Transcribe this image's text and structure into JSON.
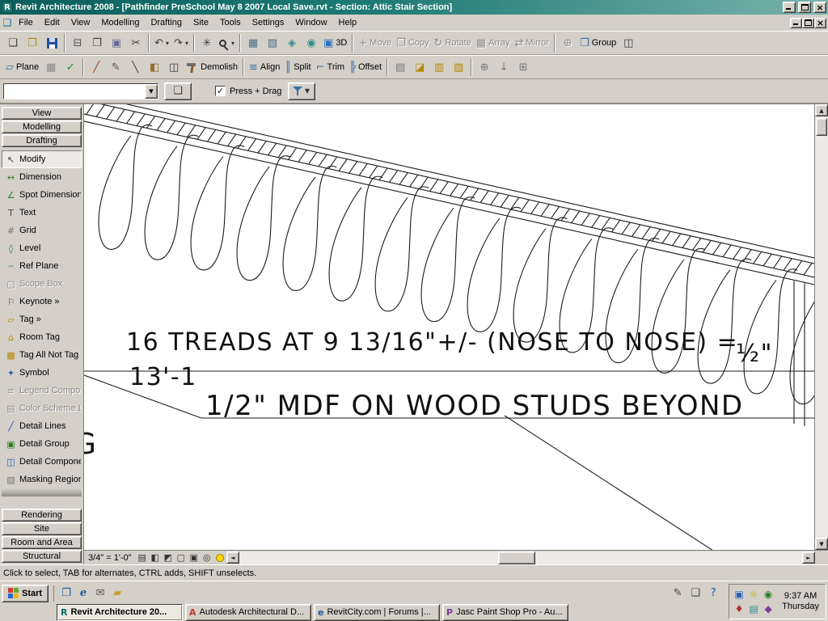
{
  "window": {
    "title": "Revit Architecture 2008 - [Pathfinder PreSchool May 8 2007 Local Save.rvt - Section: Attic Stair Section]",
    "app_icon_letter": "R",
    "close_glyph": "×"
  },
  "glyphs": {
    "up": "▲",
    "down": "▼",
    "left": "◄",
    "right": "►",
    "combo_caret": "▼"
  },
  "menu": {
    "doc_icon_glyph": "❏",
    "items": [
      {
        "name": "menu-file",
        "label": "File"
      },
      {
        "name": "menu-edit",
        "label": "Edit"
      },
      {
        "name": "menu-view",
        "label": "View"
      },
      {
        "name": "menu-modelling",
        "label": "Modelling"
      },
      {
        "name": "menu-drafting",
        "label": "Drafting"
      },
      {
        "name": "menu-site",
        "label": "Site"
      },
      {
        "name": "menu-tools",
        "label": "Tools"
      },
      {
        "name": "menu-settings",
        "label": "Settings"
      },
      {
        "name": "menu-window",
        "label": "Window"
      },
      {
        "name": "menu-help",
        "label": "Help"
      }
    ]
  },
  "toolbar1": {
    "items": [
      {
        "name": "new-button",
        "glyph": "❏"
      },
      {
        "name": "open-button",
        "glyph": "❒",
        "color": "#b8860b"
      },
      {
        "name": "save-button",
        "cls": "floppy",
        "glyph": " "
      },
      {
        "sep": true
      },
      {
        "name": "print-button",
        "glyph": "⊟",
        "color": "#555"
      },
      {
        "name": "copy-button",
        "glyph": "❐"
      },
      {
        "name": "paste-button",
        "glyph": "▣",
        "color": "#6b6b9a"
      },
      {
        "name": "cut-button",
        "glyph": "✂"
      },
      {
        "sep": true
      },
      {
        "name": "undo-button",
        "glyph": "↶",
        "caret": "▾"
      },
      {
        "name": "redo-button",
        "glyph": "↷",
        "caret": "▾"
      },
      {
        "sep": true
      },
      {
        "name": "thin-lines-button",
        "glyph": "✳"
      },
      {
        "name": "zoom-button",
        "cls": "mag",
        "glyph": " ",
        "caret": "▾"
      },
      {
        "sep": true
      },
      {
        "name": "worksets-button",
        "glyph": "▦",
        "color": "#4a708b"
      },
      {
        "name": "design-options-button",
        "glyph": "▧",
        "color": "#4a708b"
      },
      {
        "name": "dynamic-view-button",
        "glyph": "◈",
        "color": "#2e8b8b"
      },
      {
        "name": "camera-button",
        "glyph": "◉",
        "color": "#2e8b8b"
      },
      {
        "name": "default-3d-button",
        "glyph": "▣",
        "color": "#2a6fbd",
        "label": "3D"
      },
      {
        "sep": true
      },
      {
        "name": "move-button",
        "glyph": "+",
        "label": "Move",
        "disabled": true
      },
      {
        "name": "copy-tool-button",
        "glyph": "❐",
        "label": "Copy",
        "disabled": true
      },
      {
        "name": "rotate-button",
        "glyph": "↻",
        "label": "Rotate",
        "disabled": true
      },
      {
        "name": "array-button",
        "glyph": "▦",
        "label": "Array",
        "disabled": true
      },
      {
        "name": "mirror-button",
        "glyph": "⇄",
        "label": "Mirror",
        "disabled": true
      },
      {
        "sep": true
      },
      {
        "name": "pin-button",
        "glyph": "⊕",
        "disabled": true
      },
      {
        "name": "group-button",
        "glyph": "❒",
        "label": "Group",
        "color": "#3a6ea5"
      },
      {
        "name": "ungroup-button",
        "glyph": "◫"
      }
    ]
  },
  "toolbar2": {
    "items": [
      {
        "name": "work-plane-button",
        "glyph": "▱",
        "label": "Plane",
        "color": "#3a6ea5"
      },
      {
        "name": "work-plane-grid-button",
        "glyph": "▦",
        "color": "#888"
      },
      {
        "name": "spelling-button",
        "glyph": "✓",
        "color": "#2a7d2a"
      },
      {
        "sep": true
      },
      {
        "name": "tape-measure-button",
        "glyph": "╱",
        "color": "#8b4513"
      },
      {
        "name": "match-type-button",
        "glyph": "✎",
        "color": "#555"
      },
      {
        "name": "linework-button",
        "glyph": "╲"
      },
      {
        "name": "paint-button",
        "glyph": "◧",
        "color": "#9a6a2f"
      },
      {
        "name": "split-face-button",
        "glyph": "◫"
      },
      {
        "name": "demolish-button",
        "cls": "hammer",
        "glyph": " ",
        "label": "Demolish"
      },
      {
        "sep": true
      },
      {
        "name": "align-button",
        "glyph": "≡",
        "label": "Align",
        "color": "#3a6ea5"
      },
      {
        "name": "split-button",
        "glyph": "║",
        "label": "Split",
        "color": "#3a6ea5"
      },
      {
        "name": "trim-button",
        "glyph": "⌐",
        "label": "Trim",
        "color": "#3a6ea5"
      },
      {
        "name": "offset-button",
        "glyph": "╠",
        "label": "Offset",
        "color": "#3a6ea5"
      },
      {
        "sep": true
      },
      {
        "name": "view-window-button",
        "glyph": "▤",
        "color": "#777"
      },
      {
        "name": "callout-button",
        "glyph": "◪",
        "color": "#b8860b"
      },
      {
        "name": "drafting-view-button",
        "glyph": "▥",
        "color": "#b8860b"
      },
      {
        "name": "section-box-button",
        "glyph": "▧",
        "color": "#b8860b"
      },
      {
        "sep": true
      },
      {
        "name": "link-button",
        "glyph": "⊕",
        "color": "#777"
      },
      {
        "name": "import-button",
        "glyph": "↓",
        "color": "#777"
      },
      {
        "name": "manage-links-button",
        "glyph": "⊞",
        "color": "#777"
      }
    ]
  },
  "options": {
    "type_selector_value": "",
    "press_drag_label": "Press + Drag",
    "press_drag_checked": true
  },
  "design_bar": {
    "top_tabs": [
      {
        "name": "designbar-tab-view",
        "label": "View"
      },
      {
        "name": "designbar-tab-modelling",
        "label": "Modelling"
      },
      {
        "name": "designbar-tab-drafting",
        "label": "Drafting"
      }
    ],
    "tools": [
      {
        "name": "tool-modify",
        "glyph": "↖",
        "label": "Modify",
        "selected": true
      },
      {
        "name": "tool-dimension",
        "glyph": "↔",
        "label": "Dimension",
        "color": "#2a7d2a"
      },
      {
        "name": "tool-spot-dimension",
        "glyph": "∠",
        "label": "Spot Dimension",
        "color": "#2a7d2a"
      },
      {
        "name": "tool-text",
        "glyph": "T",
        "label": "Text"
      },
      {
        "name": "tool-grid",
        "glyph": "#",
        "label": "Grid",
        "color": "#777"
      },
      {
        "name": "tool-level",
        "glyph": "◊",
        "label": "Level",
        "color": "#2a7d2a"
      },
      {
        "name": "tool-ref-plane",
        "glyph": "┄",
        "label": "Ref Plane",
        "color": "#2a7d2a"
      },
      {
        "name": "tool-scope-box",
        "glyph": "▢",
        "label": "Scope Box",
        "disabled": true
      },
      {
        "name": "tool-keynote",
        "glyph": "⚐",
        "label": "Keynote »",
        "color": "#8b4513"
      },
      {
        "name": "tool-tag",
        "glyph": "▱",
        "label": "Tag »",
        "color": "#b8860b"
      },
      {
        "name": "tool-room-tag",
        "glyph": "⌂",
        "label": "Room Tag",
        "color": "#b8860b"
      },
      {
        "name": "tool-tag-all",
        "glyph": "▩",
        "label": "Tag All Not Tag",
        "color": "#b8860b"
      },
      {
        "name": "tool-symbol",
        "glyph": "✦",
        "label": "Symbol",
        "color": "#2a5db0"
      },
      {
        "name": "tool-legend-component",
        "glyph": "≡",
        "label": "Legend Compor",
        "disabled": true
      },
      {
        "name": "tool-color-scheme",
        "glyph": "▤",
        "label": "Color Scheme L",
        "disabled": true
      },
      {
        "name": "tool-detail-lines",
        "glyph": "╱",
        "label": "Detail Lines",
        "color": "#2a5db0"
      },
      {
        "name": "tool-detail-group",
        "glyph": "▣",
        "label": "Detail Group",
        "color": "#2a7d2a"
      },
      {
        "name": "tool-detail-component",
        "glyph": "◫",
        "label": "Detail Compone",
        "color": "#2a5db0"
      },
      {
        "name": "tool-masking-region",
        "glyph": "▨",
        "label": "Masking Region",
        "color": "#777"
      }
    ],
    "bottom_tabs": [
      {
        "name": "designbar-tab-rendering",
        "label": "Rendering"
      },
      {
        "name": "designbar-tab-site",
        "label": "Site"
      },
      {
        "name": "designbar-tab-room-and-area",
        "label": "Room and Area"
      },
      {
        "name": "designbar-tab-structural",
        "label": "Structural"
      }
    ]
  },
  "drawing": {
    "treads_note": "16 TREADS AT 9 13/16\"+/- (NOSE TO NOSE) =",
    "treads_note2": "13'-1",
    "half_inch": "½\"",
    "mdf_note": "1/2\" MDF ON WOOD STUDS BEYOND",
    "partial_letter": "G"
  },
  "view_bar": {
    "scale": "3/4\" = 1'-0\"",
    "icons": [
      {
        "name": "detail-level-icon",
        "glyph": "▤"
      },
      {
        "name": "model-graphics-icon",
        "glyph": "◧"
      },
      {
        "name": "shadows-icon",
        "glyph": "◩"
      },
      {
        "name": "crop-region-icon",
        "glyph": "▢"
      },
      {
        "name": "show-crop-icon",
        "glyph": "▣"
      },
      {
        "name": "hide-isolate-icon",
        "glyph": "◎"
      },
      {
        "name": "reveal-hidden-icon",
        "glyph": " ",
        "cls": "bulb"
      }
    ]
  },
  "status_bar": {
    "text": "Click to select, TAB for alternates, CTRL adds, SHIFT unselects."
  },
  "taskbar": {
    "start_label": "Start",
    "quick_launch": [
      {
        "name": "show-desktop-icon",
        "glyph": "❐",
        "color": "#1b5aa0"
      },
      {
        "name": "ie-icon",
        "glyph": "e",
        "color": "#1b5aa0",
        "cls": "ie"
      },
      {
        "name": "mail-icon",
        "glyph": "✉",
        "color": "#555"
      },
      {
        "name": "folder-icon",
        "glyph": "▰",
        "color": "#c8a02a"
      }
    ],
    "mid_icons": [
      {
        "name": "pencil-icon",
        "glyph": "✎",
        "color": "#444"
      },
      {
        "name": "notes-icon",
        "glyph": "❑",
        "color": "#444"
      },
      {
        "name": "help-icon",
        "glyph": "?",
        "color": "#1b5aa0"
      }
    ],
    "tasks": [
      {
        "name": "task-revit",
        "icon": "R",
        "color": "#0e6968",
        "label": "Revit Architecture 20...",
        "active": true
      },
      {
        "name": "task-autodesk",
        "icon": "A",
        "color": "#c0392b",
        "label": "Autodesk Architectural D..."
      },
      {
        "name": "task-revitcity",
        "icon": "e",
        "color": "#1b5aa0",
        "label": "RevitCity.com | Forums |..."
      },
      {
        "name": "task-paintshop",
        "icon": "P",
        "color": "#7d3c98",
        "label": "Jasc Paint Shop Pro - Au..."
      }
    ],
    "tray_icons": [
      {
        "name": "tray-icon-display",
        "glyph": "▣",
        "color": "#2a5db0"
      },
      {
        "name": "tray-icon-volume",
        "glyph": "☼",
        "color": "#c8a000"
      },
      {
        "name": "tray-icon-network",
        "glyph": "◉",
        "color": "#2a7d2a"
      },
      {
        "name": "tray-icon-antivirus",
        "glyph": "♦",
        "color": "#b03030"
      },
      {
        "name": "tray-icon-graphics",
        "glyph": "▤",
        "color": "#2e8b8b"
      },
      {
        "name": "tray-icon-misc",
        "glyph": "◆",
        "color": "#7d3c98"
      }
    ],
    "clock": {
      "time": "9:37 AM",
      "day": "Thursday"
    }
  }
}
